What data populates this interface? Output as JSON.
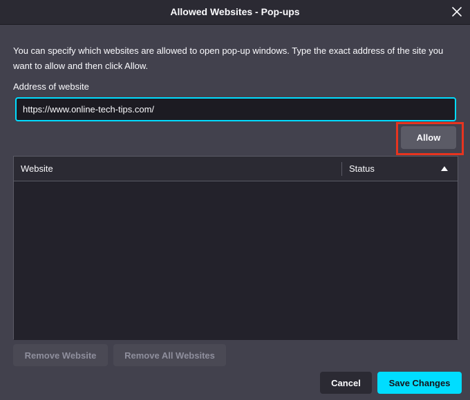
{
  "window": {
    "title": "Allowed Websites - Pop-ups",
    "close_icon": "close-icon"
  },
  "description": "You can specify which websites are allowed to open pop-up windows. Type the exact address of the site you want to allow and then click Allow.",
  "address": {
    "label": "Address of website",
    "value": "https://www.online-tech-tips.com/"
  },
  "allow_button": "Allow",
  "table": {
    "columns": [
      "Website",
      "Status"
    ],
    "sort_column": "Status",
    "sort_direction": "ascending",
    "rows": []
  },
  "buttons": {
    "remove_website": "Remove Website",
    "remove_all": "Remove All Websites",
    "cancel": "Cancel",
    "save": "Save Changes"
  },
  "colors": {
    "accent": "#00ddff",
    "highlight": "#e8341f"
  }
}
